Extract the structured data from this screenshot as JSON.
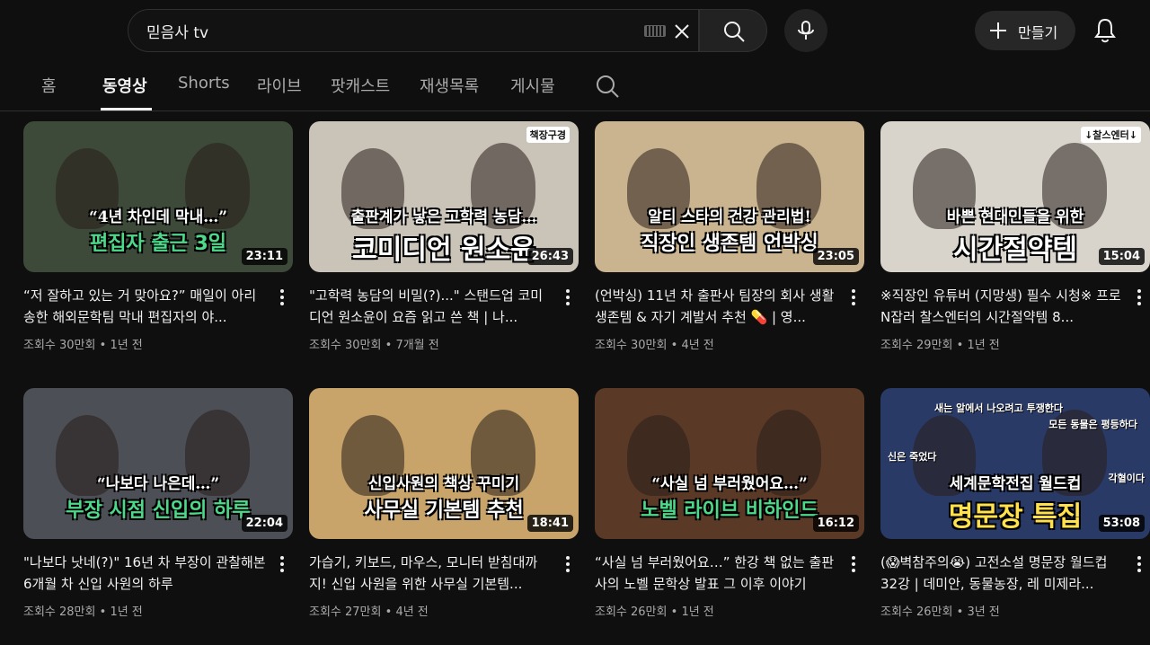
{
  "header": {
    "search_value": "믿음사 tv",
    "create_label": "만들기"
  },
  "tabs": [
    "홈",
    "동영상",
    "Shorts",
    "라이브",
    "팟캐스트",
    "재생목록",
    "게시물"
  ],
  "active_tab": "동영상",
  "videos": [
    {
      "title": "“저 잘하고 있는 거 맞아요?” 매일이 아리송한 해외문학팀 막내 편집자의 야...",
      "views": "조회수 30만회",
      "age": "1년 전",
      "duration": "23:11",
      "thumb_line1": "“4년 차인데 막내…”",
      "thumb_line2": "편집자 출근 3일",
      "thumb_bg": "#3d4a3a",
      "thumb_line2_color": "#4dd88a"
    },
    {
      "title": "\"고학력 농담의 비밀(?)...\" 스탠드업 코미디언 원소윤이 요즘 읽고 쓴 책 | 나...",
      "views": "조회수 30만회",
      "age": "7개월 전",
      "duration": "26:43",
      "thumb_line1": "출판계가 낳은 고학력 농담…",
      "thumb_line2": "코미디언 원소윤",
      "thumb_badge": "책장구경",
      "thumb_bg": "#c9c3b8",
      "thumb_line2_color": "#ffffff"
    },
    {
      "title": "(언박싱) 11년 차 출판사 팀장의 회사 생활 생존템 & 자기 계발서 추천 💊 | 영...",
      "views": "조회수 30만회",
      "age": "4년 전",
      "duration": "23:05",
      "thumb_line1": "알티 스타의 건강 관리법!",
      "thumb_line2": "직장인 생존템 언박싱",
      "thumb_bg": "#c9b48f",
      "thumb_line2_color": "#ffffff"
    },
    {
      "title": "※직장인 유튜버 (지망생) 필수 시청※ 프로N잡러 찰스엔터의 시간절약템 8...",
      "views": "조회수 29만회",
      "age": "1년 전",
      "duration": "15:04",
      "thumb_line1": "바쁜 현대인들을 위한",
      "thumb_line2": "시간절약템",
      "thumb_badge": "↓찰스엔터↓",
      "thumb_bg": "#d8d4cc",
      "thumb_line2_color": "#ffffff"
    },
    {
      "title": "\"나보다 낫네(?)\" 16년 차 부장이 관찰해본 6개월 차 신입 사원의 하루",
      "views": "조회수 28만회",
      "age": "1년 전",
      "duration": "22:04",
      "thumb_line1": "“나보다 나은데…”",
      "thumb_line2": "부장 시점 신입의 하루",
      "thumb_bg": "#4c4f55",
      "thumb_line2_color": "#4dd88a"
    },
    {
      "title": "가습기, 키보드, 마우스, 모니터 받침대까지! 신입 사원을 위한 사무실 기본템...",
      "views": "조회수 27만회",
      "age": "4년 전",
      "duration": "18:41",
      "thumb_line1": "신입사원의 책상 꾸미기",
      "thumb_line2": "사무실 기본템 추천",
      "thumb_bg": "#c8a46a",
      "thumb_line2_color": "#ffffff"
    },
    {
      "title": "“사실 넘 부러웠어요…” 한강 책 없는 출판사의 노벨 문학상 발표 그 이후 이야기",
      "views": "조회수 26만회",
      "age": "1년 전",
      "duration": "16:12",
      "thumb_line1": "“사실 넘 부러웠어요…”",
      "thumb_line2": "노벨 라이브 비하인드",
      "thumb_bg": "#5a3a26",
      "thumb_line2_color": "#4dd88a"
    },
    {
      "title": "(😱벽참주의😭) 고전소설 명문장 월드컵 32강 | 데미안, 동물농장, 레 미제라...",
      "views": "조회수 26만회",
      "age": "3년 전",
      "duration": "53:08",
      "thumb_line1": "세계문학전집 월드컵",
      "thumb_line2": "명문장 특집",
      "thumb_caption_a": "새는 알에서 나오려고 투쟁한다",
      "thumb_caption_b": "모든 동물은 평등하다",
      "thumb_caption_c": "신은 죽었다",
      "thumb_caption_d": "각혈이다",
      "thumb_bg": "#2a3a66",
      "thumb_line2_color": "#ffe14d"
    }
  ]
}
